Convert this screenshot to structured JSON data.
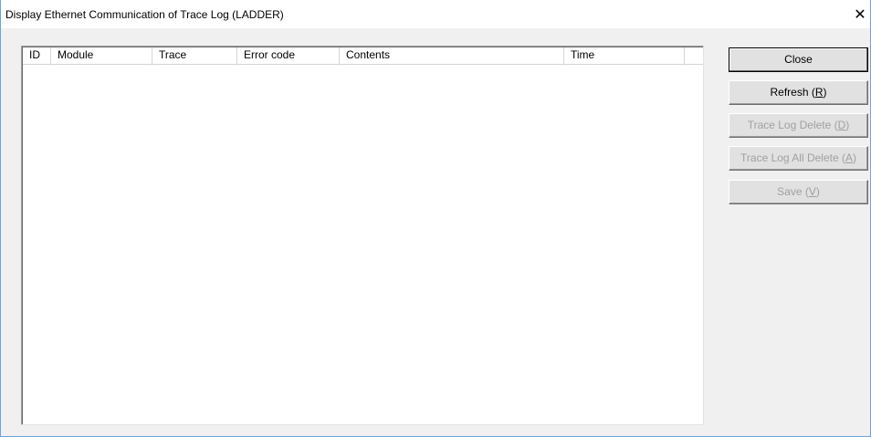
{
  "window": {
    "title": "Display Ethernet Communication of Trace Log (LADDER)",
    "close_glyph": "✕"
  },
  "table": {
    "columns": [
      "ID",
      "Module",
      "Trace",
      "Error code",
      "Contents",
      "Time"
    ],
    "rows": []
  },
  "buttons": {
    "close": {
      "label": "Close"
    },
    "refresh": {
      "label_pre": "Refresh (",
      "mnemonic": "R",
      "label_post": ")"
    },
    "trace_log_delete": {
      "label_pre": "Trace Log Delete (",
      "mnemonic": "D",
      "label_post": ")"
    },
    "trace_log_all_delete": {
      "label_pre": "Trace Log All Delete (",
      "mnemonic": "A",
      "label_post": ")"
    },
    "save": {
      "label_pre": "Save (",
      "mnemonic": "V",
      "label_post": ")"
    }
  },
  "colors": {
    "window_border": "#6aa3d8",
    "dialog_background": "#f0f0f0",
    "disabled_text": "#a0a0a0"
  }
}
